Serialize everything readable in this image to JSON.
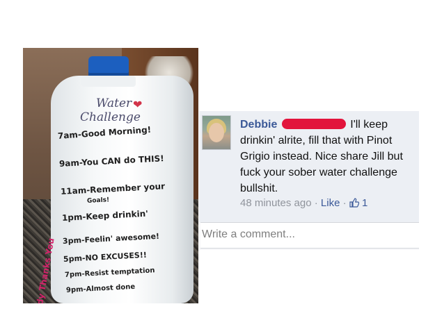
{
  "photo": {
    "title_line1": "Water",
    "title_line2": "Challenge",
    "side_text": "Your Body Thanks You",
    "schedule": [
      "7am-Good Morning!",
      "9am-You CAN do THIS!",
      "11am-Remember your",
      "Goals!",
      "1pm-Keep drinkin'",
      "3pm-Feelin' awesome!",
      "5pm-NO EXCUSES!!",
      "7pm-Resist temptation",
      "9pm-Almost done"
    ]
  },
  "comment": {
    "author": "Debbie",
    "text": "I'll keep drinkin' alrite, fill that with Pinot Grigio instead. Nice share Jill but fuck your sober water challenge bullshit.",
    "time": "48 minutes ago",
    "separator": "·",
    "like_label": "Like",
    "like_count": "1",
    "thumb_icon": "thumbs-up-icon"
  },
  "write_comment": {
    "placeholder": "Write a comment..."
  },
  "colors": {
    "author_link": "#3b5998",
    "redaction": "#e2143c",
    "cap_blue": "#1c5fbf"
  }
}
